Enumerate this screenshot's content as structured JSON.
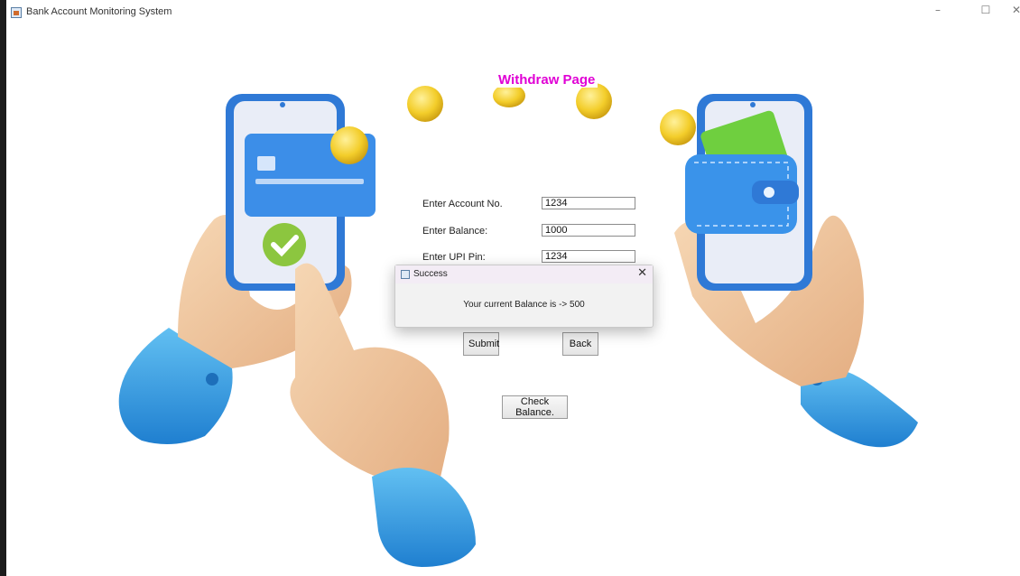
{
  "window": {
    "title": "Bank Account Monitoring System",
    "controls": {
      "minimize": "–",
      "maximize": "☐",
      "close": "✕"
    }
  },
  "page": {
    "title": "Withdraw Page",
    "title_color": "#e000d5"
  },
  "form": {
    "account_label": "Enter Account No.",
    "account_value": "1234",
    "balance_label": "Enter Balance:",
    "balance_value": "1000",
    "pin_label": "Enter UPI Pin:",
    "pin_value": "1234"
  },
  "buttons": {
    "submit": "Submit",
    "back": "Back",
    "check_balance": "Check Balance."
  },
  "dialog": {
    "title": "Success",
    "close_icon": "✕",
    "message": "Your current Balance is -> 500"
  },
  "illustration": {
    "subject": "hands holding smartphones with card, wallet and coins",
    "colors": {
      "phone_blue": "#2f79d6",
      "card_blue": "#3c8ee8",
      "skin": "#f1c79c",
      "sleeve": "#3aa0e6",
      "coin": "#f2cc2e",
      "check_green": "#8cc63f"
    }
  }
}
